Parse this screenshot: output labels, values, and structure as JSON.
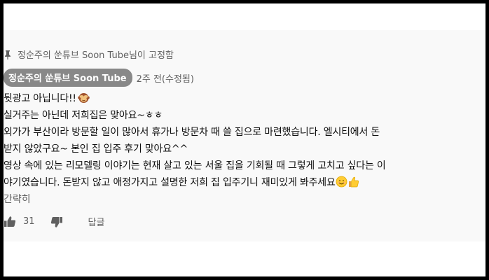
{
  "pinned": {
    "text": "정순주의 쑨튜브 Soon Tube님이 고정함",
    "icon": "pin-icon"
  },
  "comment": {
    "author": "정순주의 쑨튜브 Soon Tube",
    "time": "2주 전(수정됨)",
    "lines": [
      "뒷광고 아닙니다!!",
      "실거주는 아닌데 저희집은 맞아요~ㅎㅎ",
      "외가가 부산이라 방문할 일이 많아서 휴가나 방문차 때 쓸 집으로 마련했습니다. 엘시티에서 돈",
      "받지 않았구요~ 본인 집 입주 후기 맞아요^^",
      "영상 속에 있는 리모델링 이야기는 현재 살고 있는 서울 집을 기회될 때 그렇게 고치고 싶다는 이",
      "야기였습니다. 돈받지 않고 애정가지고 설명한 저희 집 입주기니 재미있게 봐주세요"
    ],
    "collapse_label": "간략히",
    "like_count": "31",
    "reply_label": "답글",
    "emojis": [
      "see-no-evil-monkey",
      "smiling-face",
      "thumbs-up"
    ]
  },
  "colors": {
    "author_chip_bg": "#888888",
    "comment_bg": "#f9f9f9",
    "secondary_text": "#606060"
  }
}
